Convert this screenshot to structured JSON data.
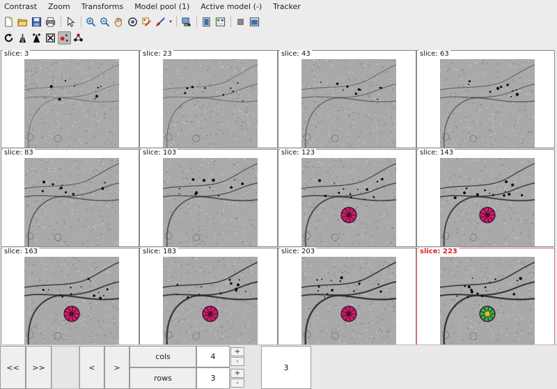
{
  "menubar": {
    "items": [
      "Contrast",
      "Zoom",
      "Transforms",
      "Model pool (1)",
      "Active model (-)",
      "Tracker"
    ]
  },
  "toolbar1": {
    "buttons": [
      "new-document-icon",
      "open-folder-icon",
      "save-icon",
      "print-icon",
      "pointer-icon",
      "zoom-in-icon",
      "zoom-out-icon",
      "hand-pan-icon",
      "rotate-icon",
      "model-tool-icon",
      "brush-icon",
      "tool-menu-caret-icon",
      "network-icon",
      "panel-tall-icon",
      "panel-split-icon",
      "square-stop-icon",
      "window-icon"
    ]
  },
  "toolbar2": {
    "buttons": [
      "refresh-icon",
      "sharpen-icon",
      "sharpen-plus-icon",
      "crop-expand-icon",
      "dot-marker-icon",
      "atom-cluster-icon"
    ]
  },
  "grid": {
    "slice_prefix": "slice: ",
    "cells": [
      {
        "label": "slice: 3",
        "marker": "none"
      },
      {
        "label": "slice: 23",
        "marker": "none"
      },
      {
        "label": "slice: 43",
        "marker": "none"
      },
      {
        "label": "slice: 63",
        "marker": "none"
      },
      {
        "label": "slice: 83",
        "marker": "none"
      },
      {
        "label": "slice: 103",
        "marker": "none"
      },
      {
        "label": "slice: 123",
        "marker": "magenta"
      },
      {
        "label": "slice: 143",
        "marker": "magenta"
      },
      {
        "label": "slice: 163",
        "marker": "magenta"
      },
      {
        "label": "slice: 183",
        "marker": "magenta"
      },
      {
        "label": "slice: 203",
        "marker": "magenta"
      },
      {
        "label": "slice: 223",
        "marker": "green",
        "selected": true
      }
    ]
  },
  "controls": {
    "first_label": "<<",
    "last_label": ">>",
    "prev_label": "<",
    "next_label": ">",
    "cols_label": "cols",
    "cols_value": "4",
    "rows_label": "rows",
    "rows_value": "3",
    "spin_up": "+",
    "spin_down": "-",
    "current_value": "3"
  },
  "colors": {
    "selected_label": "#e02020",
    "marker_magenta": "#c81e6e",
    "marker_green": "#3aa84a"
  }
}
